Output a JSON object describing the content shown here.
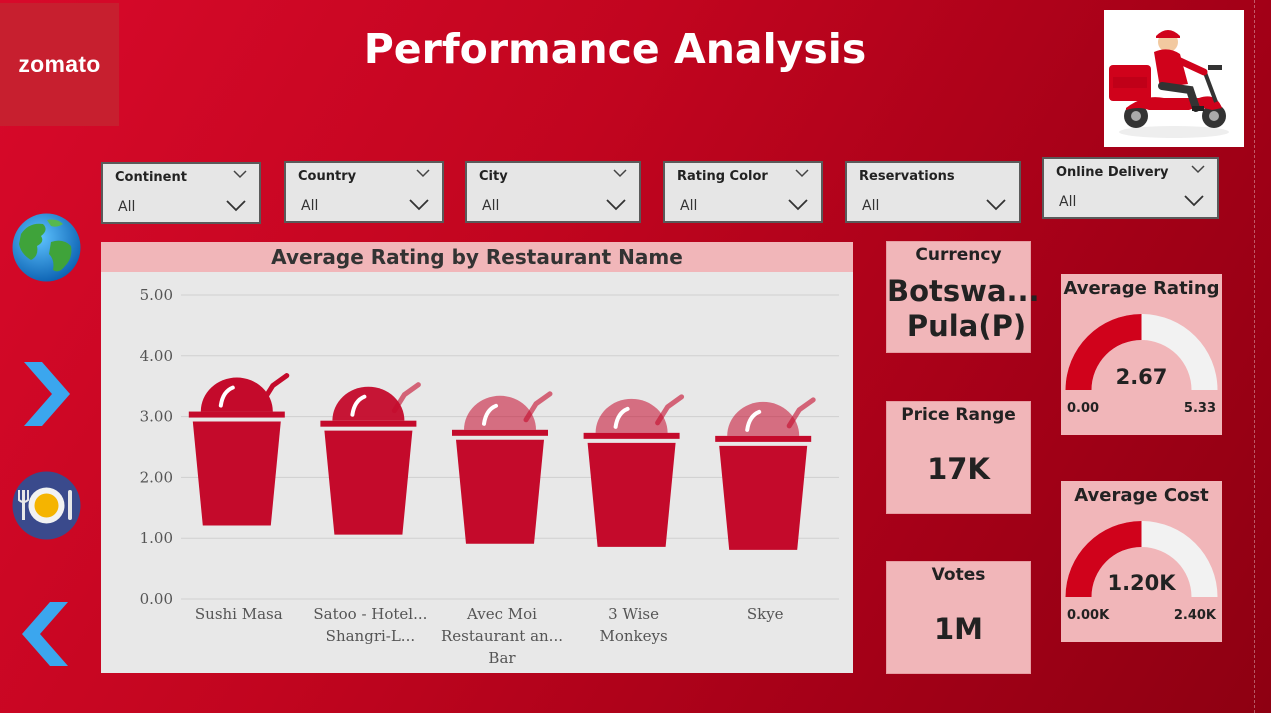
{
  "header": {
    "logo_text": "zomato",
    "title": "Performance Analysis"
  },
  "slicers": [
    {
      "label": "Continent",
      "value": "All"
    },
    {
      "label": "Country",
      "value": "All"
    },
    {
      "label": "City",
      "value": "All"
    },
    {
      "label": "Rating Color",
      "value": "All"
    },
    {
      "label": "Reservations",
      "value": "All"
    },
    {
      "label": "Online Delivery",
      "value": "All"
    }
  ],
  "nav": {
    "icons": [
      "globe-icon",
      "next-arrow-icon",
      "plate-icon",
      "prev-arrow-icon"
    ]
  },
  "chart_data": {
    "type": "bar",
    "title": "Average Rating by Restaurant Name",
    "categories": [
      [
        "Sushi Masa"
      ],
      [
        "Satoo - Hotel...",
        "Shangri-L..."
      ],
      [
        "Avec Moi",
        "Restaurant an...",
        "Bar"
      ],
      [
        "3 Wise",
        "Monkeys"
      ],
      [
        "Skye"
      ]
    ],
    "values": [
      3.05,
      2.9,
      2.75,
      2.7,
      2.65
    ],
    "y_ticks": [
      "0.00",
      "1.00",
      "2.00",
      "3.00",
      "4.00",
      "5.00"
    ],
    "ylim": [
      0,
      5
    ],
    "grid": true,
    "bar_color": "#c40a2b"
  },
  "cards": {
    "currency": {
      "title": "Currency",
      "line1": "Botswa...",
      "line2": "Pula(P)"
    },
    "price_range": {
      "title": "Price Range",
      "value": "17K"
    },
    "votes": {
      "title": "Votes",
      "value": "1M"
    }
  },
  "gauges": {
    "average_rating": {
      "title": "Average Rating",
      "value": 2.67,
      "value_label": "2.67",
      "min": "0.00",
      "max": "5.33",
      "fraction": 0.5
    },
    "average_cost": {
      "title": "Average Cost",
      "value": 1.2,
      "value_label": "1.20K",
      "min": "0.00K",
      "max": "2.40K",
      "fraction": 0.5
    }
  },
  "colors": {
    "accent": "#d0021b",
    "card_bg": "#f1b6b9",
    "gauge_fill": "#d0021b",
    "gauge_track": "#f2f2f2"
  }
}
